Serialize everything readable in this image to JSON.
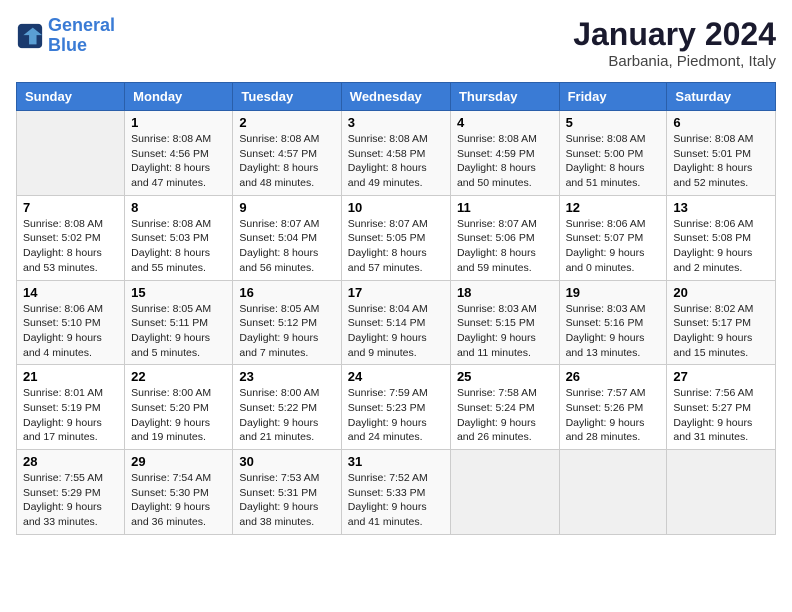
{
  "logo": {
    "line1": "General",
    "line2": "Blue"
  },
  "title": "January 2024",
  "subtitle": "Barbania, Piedmont, Italy",
  "days_of_week": [
    "Sunday",
    "Monday",
    "Tuesday",
    "Wednesday",
    "Thursday",
    "Friday",
    "Saturday"
  ],
  "weeks": [
    [
      {
        "day": "",
        "info": ""
      },
      {
        "day": "1",
        "info": "Sunrise: 8:08 AM\nSunset: 4:56 PM\nDaylight: 8 hours\nand 47 minutes."
      },
      {
        "day": "2",
        "info": "Sunrise: 8:08 AM\nSunset: 4:57 PM\nDaylight: 8 hours\nand 48 minutes."
      },
      {
        "day": "3",
        "info": "Sunrise: 8:08 AM\nSunset: 4:58 PM\nDaylight: 8 hours\nand 49 minutes."
      },
      {
        "day": "4",
        "info": "Sunrise: 8:08 AM\nSunset: 4:59 PM\nDaylight: 8 hours\nand 50 minutes."
      },
      {
        "day": "5",
        "info": "Sunrise: 8:08 AM\nSunset: 5:00 PM\nDaylight: 8 hours\nand 51 minutes."
      },
      {
        "day": "6",
        "info": "Sunrise: 8:08 AM\nSunset: 5:01 PM\nDaylight: 8 hours\nand 52 minutes."
      }
    ],
    [
      {
        "day": "7",
        "info": "Sunrise: 8:08 AM\nSunset: 5:02 PM\nDaylight: 8 hours\nand 53 minutes."
      },
      {
        "day": "8",
        "info": "Sunrise: 8:08 AM\nSunset: 5:03 PM\nDaylight: 8 hours\nand 55 minutes."
      },
      {
        "day": "9",
        "info": "Sunrise: 8:07 AM\nSunset: 5:04 PM\nDaylight: 8 hours\nand 56 minutes."
      },
      {
        "day": "10",
        "info": "Sunrise: 8:07 AM\nSunset: 5:05 PM\nDaylight: 8 hours\nand 57 minutes."
      },
      {
        "day": "11",
        "info": "Sunrise: 8:07 AM\nSunset: 5:06 PM\nDaylight: 8 hours\nand 59 minutes."
      },
      {
        "day": "12",
        "info": "Sunrise: 8:06 AM\nSunset: 5:07 PM\nDaylight: 9 hours\nand 0 minutes."
      },
      {
        "day": "13",
        "info": "Sunrise: 8:06 AM\nSunset: 5:08 PM\nDaylight: 9 hours\nand 2 minutes."
      }
    ],
    [
      {
        "day": "14",
        "info": "Sunrise: 8:06 AM\nSunset: 5:10 PM\nDaylight: 9 hours\nand 4 minutes."
      },
      {
        "day": "15",
        "info": "Sunrise: 8:05 AM\nSunset: 5:11 PM\nDaylight: 9 hours\nand 5 minutes."
      },
      {
        "day": "16",
        "info": "Sunrise: 8:05 AM\nSunset: 5:12 PM\nDaylight: 9 hours\nand 7 minutes."
      },
      {
        "day": "17",
        "info": "Sunrise: 8:04 AM\nSunset: 5:14 PM\nDaylight: 9 hours\nand 9 minutes."
      },
      {
        "day": "18",
        "info": "Sunrise: 8:03 AM\nSunset: 5:15 PM\nDaylight: 9 hours\nand 11 minutes."
      },
      {
        "day": "19",
        "info": "Sunrise: 8:03 AM\nSunset: 5:16 PM\nDaylight: 9 hours\nand 13 minutes."
      },
      {
        "day": "20",
        "info": "Sunrise: 8:02 AM\nSunset: 5:17 PM\nDaylight: 9 hours\nand 15 minutes."
      }
    ],
    [
      {
        "day": "21",
        "info": "Sunrise: 8:01 AM\nSunset: 5:19 PM\nDaylight: 9 hours\nand 17 minutes."
      },
      {
        "day": "22",
        "info": "Sunrise: 8:00 AM\nSunset: 5:20 PM\nDaylight: 9 hours\nand 19 minutes."
      },
      {
        "day": "23",
        "info": "Sunrise: 8:00 AM\nSunset: 5:22 PM\nDaylight: 9 hours\nand 21 minutes."
      },
      {
        "day": "24",
        "info": "Sunrise: 7:59 AM\nSunset: 5:23 PM\nDaylight: 9 hours\nand 24 minutes."
      },
      {
        "day": "25",
        "info": "Sunrise: 7:58 AM\nSunset: 5:24 PM\nDaylight: 9 hours\nand 26 minutes."
      },
      {
        "day": "26",
        "info": "Sunrise: 7:57 AM\nSunset: 5:26 PM\nDaylight: 9 hours\nand 28 minutes."
      },
      {
        "day": "27",
        "info": "Sunrise: 7:56 AM\nSunset: 5:27 PM\nDaylight: 9 hours\nand 31 minutes."
      }
    ],
    [
      {
        "day": "28",
        "info": "Sunrise: 7:55 AM\nSunset: 5:29 PM\nDaylight: 9 hours\nand 33 minutes."
      },
      {
        "day": "29",
        "info": "Sunrise: 7:54 AM\nSunset: 5:30 PM\nDaylight: 9 hours\nand 36 minutes."
      },
      {
        "day": "30",
        "info": "Sunrise: 7:53 AM\nSunset: 5:31 PM\nDaylight: 9 hours\nand 38 minutes."
      },
      {
        "day": "31",
        "info": "Sunrise: 7:52 AM\nSunset: 5:33 PM\nDaylight: 9 hours\nand 41 minutes."
      },
      {
        "day": "",
        "info": ""
      },
      {
        "day": "",
        "info": ""
      },
      {
        "day": "",
        "info": ""
      }
    ]
  ]
}
